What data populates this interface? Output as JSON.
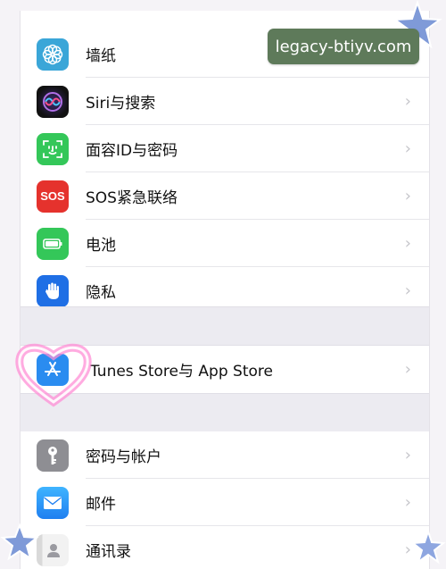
{
  "settings": {
    "wallpaper": "墙纸",
    "siri": "Siri与搜索",
    "faceid": "面容ID与密码",
    "sos": "SOS紧急联络",
    "battery": "电池",
    "privacy": "隐私",
    "appstore": "Tunes Store与 App Store",
    "passwords": "密码与帐户",
    "mail": "邮件",
    "contacts": "通讯录"
  },
  "icons": {
    "wallpaper": "flower-icon",
    "siri": "siri-icon",
    "faceid": "face-id-icon",
    "sos": "sos-icon",
    "sos_text": "SOS",
    "battery": "battery-icon",
    "privacy": "hand-icon",
    "appstore": "app-store-icon",
    "passwords": "key-icon",
    "mail": "envelope-icon",
    "contacts": "contacts-icon"
  },
  "colors": {
    "wallpaper": "#3aa6d8",
    "faceid": "#34c759",
    "sos": "#e5322d",
    "battery": "#34c759",
    "privacy": "#1f6fe5",
    "appstore": "#2a8cf0",
    "passwords": "#8e8e93",
    "mail": "#2a8cf0"
  },
  "watermark": "legacy-btiyv.com"
}
